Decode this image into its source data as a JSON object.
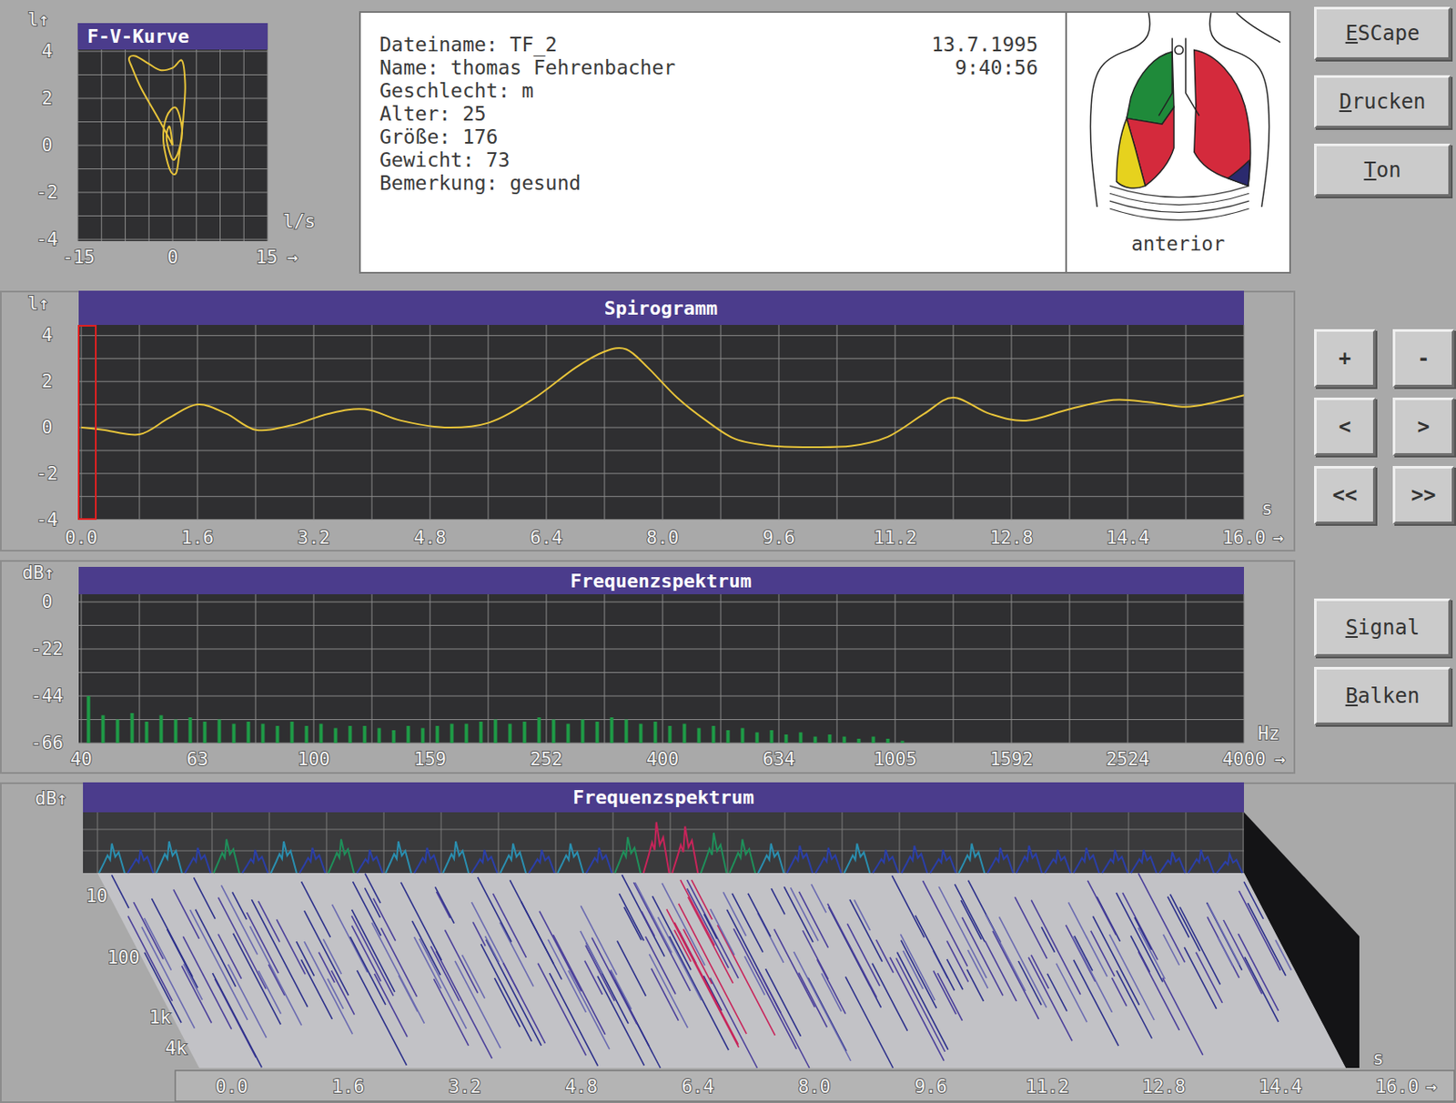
{
  "fv_curve": {
    "title": "F-V-Kurve",
    "y_unit": "l↑",
    "y_ticks": [
      "4",
      "2",
      "0",
      "-2",
      "-4"
    ],
    "x_unit": "l/s",
    "x_ticks": [
      "-15",
      "0",
      "15"
    ],
    "x_arrow": "→",
    "flow": [
      0,
      -2,
      -5,
      -6.5,
      -7,
      -6,
      -4,
      -2,
      0,
      1.5,
      2,
      1.8,
      1.5,
      1,
      0.5,
      -0.5,
      -1.5,
      -1,
      0.5,
      1.5,
      1,
      0,
      -1,
      -0.5,
      0
    ],
    "volume": [
      0,
      1,
      2.4,
      3.3,
      3.7,
      3.8,
      3.5,
      3.2,
      3.3,
      3.6,
      2.6,
      1.5,
      0.6,
      -0.5,
      -1.2,
      -1.0,
      0.2,
      1.2,
      1.6,
      0.7,
      -0.2,
      -0.6,
      0.3,
      0.8,
      0
    ]
  },
  "patient": {
    "fields": [
      {
        "label": "Dateiname:",
        "value": "TF_2"
      },
      {
        "label": "Name:",
        "value": "thomas Fehrenbacher"
      },
      {
        "label": "Geschlecht:",
        "value": "m"
      },
      {
        "label": "Alter:",
        "value": "25"
      },
      {
        "label": "Größe:",
        "value": "176"
      },
      {
        "label": "Gewicht:",
        "value": "73"
      },
      {
        "label": "Bemerkung:",
        "value": "gesund"
      }
    ],
    "date": "13.7.1995",
    "time": "9:40:56"
  },
  "lung_map": {
    "view": "anterior",
    "regions": [
      {
        "color": "#1f8a3a"
      },
      {
        "color": "#d42a3c"
      },
      {
        "color": "#e6d21e"
      },
      {
        "color": "#d42a3c"
      },
      {
        "color": "#2b2a6e"
      }
    ]
  },
  "menu_buttons": [
    "ESCape",
    "Drucken",
    "Ton"
  ],
  "spirogram": {
    "title": "Spirogramm",
    "y_unit": "l↑",
    "y_ticks": [
      "4",
      "2",
      "0",
      "-2",
      "-4"
    ],
    "x_unit": "s",
    "x_ticks": [
      "0.0",
      "1.6",
      "3.2",
      "4.8",
      "6.4",
      "8.0",
      "9.6",
      "11.2",
      "12.8",
      "14.4",
      "16.0"
    ],
    "x_arrow": "→",
    "cursor": 0,
    "times": [
      0,
      0.3,
      0.8,
      1.2,
      1.6,
      2.0,
      2.4,
      2.9,
      3.4,
      3.9,
      4.4,
      5.0,
      5.6,
      6.2,
      6.8,
      7.2,
      7.5,
      7.8,
      8.2,
      8.6,
      9.0,
      9.5,
      10.0,
      10.6,
      11.1,
      11.6,
      12.0,
      12.5,
      13.0,
      13.6,
      14.2,
      14.7,
      15.2,
      15.6,
      16.0
    ],
    "values": [
      0,
      -0.1,
      -0.3,
      0.4,
      1.0,
      0.6,
      -0.1,
      0.1,
      0.6,
      0.8,
      0.3,
      0.0,
      0.2,
      1.2,
      2.6,
      3.3,
      3.4,
      2.6,
      1.3,
      0.3,
      -0.5,
      -0.8,
      -0.85,
      -0.8,
      -0.4,
      0.6,
      1.3,
      0.6,
      0.3,
      0.8,
      1.2,
      1.1,
      0.9,
      1.1,
      1.4
    ]
  },
  "zoom_buttons": [
    "+",
    "-",
    "<",
    ">",
    "<<",
    ">>"
  ],
  "spectrum": {
    "title": "Frequenzspektrum",
    "y_unit": "dB↑",
    "y_ticks": [
      "0",
      "-22",
      "-44",
      "-66"
    ],
    "x_unit": "Hz",
    "x_ticks": [
      "40",
      "63",
      "100",
      "159",
      "252",
      "400",
      "634",
      "1005",
      "1592",
      "2524",
      "4000"
    ],
    "x_arrow": "→",
    "values": [
      -44,
      -53,
      -55,
      -52,
      -56,
      -53,
      -55,
      -54,
      -56,
      -55,
      -57,
      -56,
      -57,
      -58,
      -56,
      -58,
      -57,
      -59,
      -58,
      -58,
      -59,
      -60,
      -58,
      -59,
      -58,
      -57,
      -57,
      -56,
      -55,
      -57,
      -56,
      -54,
      -55,
      -57,
      -55,
      -56,
      -54,
      -55,
      -57,
      -56,
      -58,
      -57,
      -59,
      -58,
      -60,
      -59,
      -61,
      -60,
      -62,
      -61,
      -63,
      -62,
      -63,
      -64,
      -63,
      -64,
      -65,
      -66,
      -66,
      -66,
      -66,
      -66,
      -66,
      -66,
      -66,
      -66,
      -66,
      -66,
      -66,
      -66,
      -66,
      -66,
      -66,
      -66,
      -66,
      -66,
      -66,
      -66,
      -66,
      -66
    ]
  },
  "mode_buttons": [
    "Signal",
    "Balken"
  ],
  "waterfall": {
    "title": "Frequenzspektrum",
    "y_unit": "dB↑",
    "depth_ticks": [
      "10",
      "100",
      "1k",
      "4k"
    ],
    "x_unit": "s",
    "x_ticks": [
      "0.0",
      "1.6",
      "3.2",
      "4.8",
      "6.4",
      "8.0",
      "9.6",
      "11.2",
      "12.8",
      "14.4",
      "16.0"
    ],
    "x_arrow": "→",
    "intensity": [
      0.45,
      0.3,
      0.5,
      0.35,
      0.55,
      0.3,
      0.5,
      0.35,
      0.55,
      0.3,
      0.5,
      0.35,
      0.5,
      0.3,
      0.45,
      0.3,
      0.45,
      0.35,
      0.6,
      0.95,
      0.85,
      0.7,
      0.55,
      0.45,
      0.4,
      0.35,
      0.45,
      0.3,
      0.4,
      0.3,
      0.45,
      0.35,
      0.4,
      0.3,
      0.35,
      0.3,
      0.3,
      0.25,
      0.3,
      0.2
    ]
  }
}
